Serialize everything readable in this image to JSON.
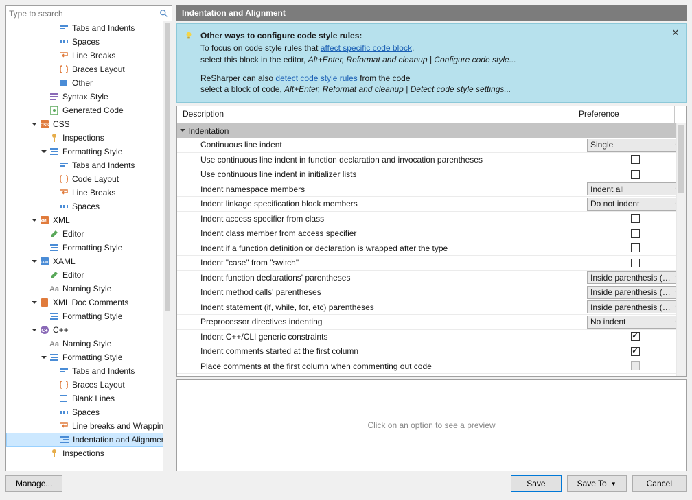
{
  "search": {
    "placeholder": "Type to search"
  },
  "page_title": "Indentation and Alignment",
  "info": {
    "title": "Other ways to configure code style rules:",
    "line1_a": "To focus on code style rules that ",
    "line1_link": "affect specific code block",
    "line1_b": ",",
    "line2_a": "select this block in the editor, ",
    "line2_i": "Alt+Enter, Reformat and cleanup | Configure code style...",
    "line3_a": "ReSharper can also ",
    "line3_link": "detect code style rules",
    "line3_b": " from the code",
    "line4_a": "select a block of code, ",
    "line4_i": "Alt+Enter, Reformat and cleanup | Detect code style settings..."
  },
  "grid": {
    "col_desc": "Description",
    "col_pref": "Preference",
    "group": "Indentation",
    "rows": [
      {
        "desc": "Continuous line indent",
        "type": "dropdown",
        "value": "Single"
      },
      {
        "desc": "Use continuous line indent in function declaration and invocation parentheses",
        "type": "checkbox",
        "checked": false
      },
      {
        "desc": "Use continuous line indent in initializer lists",
        "type": "checkbox",
        "checked": false
      },
      {
        "desc": "Indent namespace members",
        "type": "dropdown",
        "value": "Indent all"
      },
      {
        "desc": "Indent linkage specification block members",
        "type": "dropdown",
        "value": "Do not indent"
      },
      {
        "desc": "Indent access specifier from class",
        "type": "checkbox",
        "checked": false
      },
      {
        "desc": "Indent class member from access specifier",
        "type": "checkbox",
        "checked": false
      },
      {
        "desc": "Indent if a function definition or declaration is wrapped after the type",
        "type": "checkbox",
        "checked": false
      },
      {
        "desc": "Indent \"case\" from \"switch\"",
        "type": "checkbox",
        "checked": false
      },
      {
        "desc": "Indent function declarations' parentheses",
        "type": "dropdown",
        "value": "Inside parenthesis (BSD/K"
      },
      {
        "desc": "Indent method calls' parentheses",
        "type": "dropdown",
        "value": "Inside parenthesis (BSD/K"
      },
      {
        "desc": "Indent statement (if, while, for, etc) parentheses",
        "type": "dropdown",
        "value": "Inside parenthesis (BSD/K"
      },
      {
        "desc": "Preprocessor directives indenting",
        "type": "dropdown",
        "value": "No indent"
      },
      {
        "desc": "Indent C++/CLI generic constraints",
        "type": "checkbox",
        "checked": true
      },
      {
        "desc": "Indent comments started at the first column",
        "type": "checkbox",
        "checked": true
      },
      {
        "desc": "Place comments at the first column when commenting out code",
        "type": "checkbox",
        "checked": false,
        "disabled": true
      }
    ]
  },
  "tree": [
    {
      "indent": 4,
      "label": "Tabs and Indents",
      "icon": "tabs"
    },
    {
      "indent": 4,
      "label": "Spaces",
      "icon": "spaces"
    },
    {
      "indent": 4,
      "label": "Line Breaks",
      "icon": "linebreaks"
    },
    {
      "indent": 4,
      "label": "Braces Layout",
      "icon": "braces"
    },
    {
      "indent": 4,
      "label": "Other",
      "icon": "other"
    },
    {
      "indent": 3,
      "label": "Syntax Style",
      "icon": "syntax"
    },
    {
      "indent": 3,
      "label": "Generated Code",
      "icon": "generated"
    },
    {
      "indent": 2,
      "label": "CSS",
      "icon": "css",
      "arrow": "down"
    },
    {
      "indent": 3,
      "label": "Inspections",
      "icon": "inspections"
    },
    {
      "indent": 3,
      "label": "Formatting Style",
      "icon": "format",
      "arrow": "down"
    },
    {
      "indent": 4,
      "label": "Tabs and Indents",
      "icon": "tabs"
    },
    {
      "indent": 4,
      "label": "Code Layout",
      "icon": "braces"
    },
    {
      "indent": 4,
      "label": "Line Breaks",
      "icon": "linebreaks"
    },
    {
      "indent": 4,
      "label": "Spaces",
      "icon": "spaces"
    },
    {
      "indent": 2,
      "label": "XML",
      "icon": "xml",
      "arrow": "down"
    },
    {
      "indent": 3,
      "label": "Editor",
      "icon": "editor"
    },
    {
      "indent": 3,
      "label": "Formatting Style",
      "icon": "format"
    },
    {
      "indent": 2,
      "label": "XAML",
      "icon": "xaml",
      "arrow": "down"
    },
    {
      "indent": 3,
      "label": "Editor",
      "icon": "editor"
    },
    {
      "indent": 3,
      "label": "Naming Style",
      "icon": "naming"
    },
    {
      "indent": 2,
      "label": "XML Doc Comments",
      "icon": "xmldoc",
      "arrow": "down"
    },
    {
      "indent": 3,
      "label": "Formatting Style",
      "icon": "format"
    },
    {
      "indent": 2,
      "label": "C++",
      "icon": "cpp",
      "arrow": "down"
    },
    {
      "indent": 3,
      "label": "Naming Style",
      "icon": "naming"
    },
    {
      "indent": 3,
      "label": "Formatting Style",
      "icon": "format",
      "arrow": "down"
    },
    {
      "indent": 4,
      "label": "Tabs and Indents",
      "icon": "tabs"
    },
    {
      "indent": 4,
      "label": "Braces Layout",
      "icon": "braces"
    },
    {
      "indent": 4,
      "label": "Blank Lines",
      "icon": "blank"
    },
    {
      "indent": 4,
      "label": "Spaces",
      "icon": "spaces"
    },
    {
      "indent": 4,
      "label": "Line breaks and Wrapping",
      "icon": "linebreaks"
    },
    {
      "indent": 4,
      "label": "Indentation and Alignment",
      "icon": "indent",
      "selected": true
    },
    {
      "indent": 3,
      "label": "Inspections",
      "icon": "inspections"
    }
  ],
  "preview_text": "Click on an option to see a preview",
  "buttons": {
    "manage": "Manage...",
    "save": "Save",
    "save_to": "Save To",
    "cancel": "Cancel"
  }
}
